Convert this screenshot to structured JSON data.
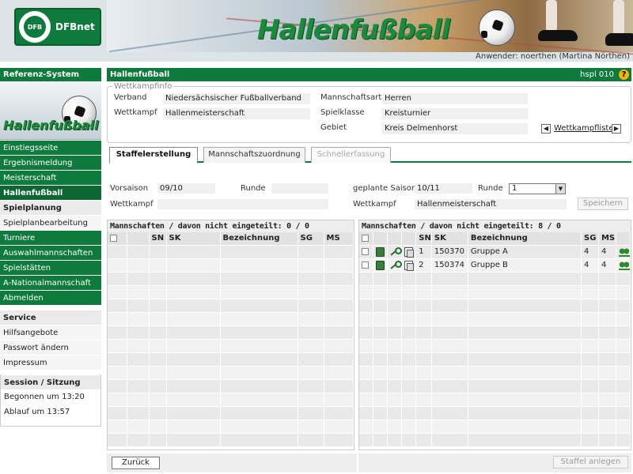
{
  "header": {
    "logo_text": "DFBnet",
    "banner_title": "Hallenfußball",
    "user_text": "Anwender: noerthen (Martina Nörthen)"
  },
  "sidebar": {
    "section1_title": "Referenz-System",
    "image_title": "Hallenfußball",
    "items1": [
      "Einstiegsseite",
      "Ergebnismeldung",
      "Meisterschaft",
      "Hallenfußball"
    ],
    "sub_title": "Spielplanung",
    "sub_item": "Spielplanbearbeitung",
    "items2": [
      "Turniere",
      "Auswahlmannschaften",
      "Spielstätten",
      "A-Nationalmannschaft",
      "Abmelden"
    ],
    "service_title": "Service",
    "service_items": [
      "Hilfsangebote",
      "Passwort ändern",
      "Impressum"
    ],
    "session_title": "Session / Sitzung",
    "session_begin": "Begonnen um 13:20",
    "session_end": "Ablauf um 13:57"
  },
  "main": {
    "title": "Hallenfußball",
    "code": "hspl 010",
    "help": "?",
    "wettkampfinfo": {
      "legend": "Wettkampfinfo",
      "verband_label": "Verband",
      "verband_value": "Niedersächsischer Fußballverband",
      "wettkampf_label": "Wettkampf",
      "wettkampf_value": "Hallenmeisterschaft",
      "mannschaftsart_label": "Mannschaftsart",
      "mannschaftsart_value": "Herren",
      "spielklasse_label": "Spielklasse",
      "spielklasse_value": "Kreisturnier",
      "gebiet_label": "Gebiet",
      "gebiet_value": "Kreis Delmenhorst",
      "link": "Wettkampfliste",
      "prev": "◀",
      "next": "▶"
    },
    "tabs": [
      "Staffelerstellung",
      "Mannschaftszuordnung",
      "Schnellerfassung"
    ],
    "form": {
      "vorsaison_label": "Vorsaison",
      "vorsaison_value": "09/10",
      "runde_label_left": "Runde",
      "wettkampf_label_left": "Wettkampf",
      "saison_label": "geplante Saison",
      "saison_value": "10/11",
      "runde_label_right": "Runde",
      "runde_value": "1",
      "wettkampf_label_right": "Wettkampf",
      "wettkampf_value": "Hallenmeisterschaft",
      "speichern": "Speichern"
    },
    "left_panel": {
      "title": "Mannschaften / davon nicht eingeteilt: 0 / 0",
      "headers": [
        "",
        "",
        "SN",
        "SK",
        "Bezeichnung",
        "SG",
        "MS"
      ]
    },
    "right_panel": {
      "title": "Mannschaften / davon nicht eingeteilt: 8 / 0",
      "headers": [
        "",
        "",
        "",
        "",
        "SN",
        "SK",
        "Bezeichnung",
        "SG",
        "MS",
        ""
      ],
      "rows": [
        {
          "sn": "1",
          "sk": "150370",
          "bez": "Gruppe A",
          "sg": "4",
          "ms": "4"
        },
        {
          "sn": "2",
          "sk": "150374",
          "bez": "Gruppe B",
          "sg": "4",
          "ms": "4"
        }
      ]
    },
    "buttons": {
      "back": "Zurück",
      "create": "Staffel anlegen"
    }
  },
  "icons": {
    "book": "book-icon",
    "key": "key-icon",
    "copy": "copy-icon",
    "team": "team-icon"
  },
  "colors": {
    "brand_green": "#0e7a3c",
    "help_yellow": "#f5b400"
  }
}
